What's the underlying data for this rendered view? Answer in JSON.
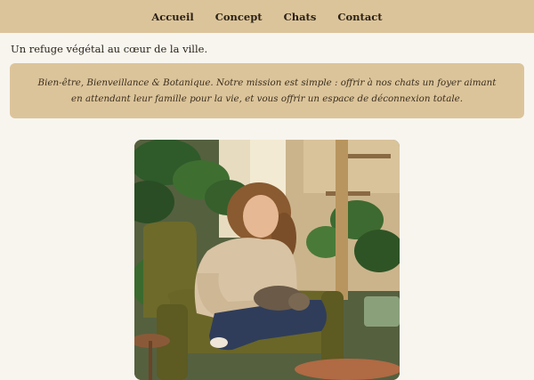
{
  "nav": {
    "items": [
      {
        "label": "Accueil"
      },
      {
        "label": "Concept"
      },
      {
        "label": "Chats"
      },
      {
        "label": "Contact"
      }
    ]
  },
  "main": {
    "tagline": "Un refuge végétal au cœur de la ville.",
    "mission": "Bien-être, Bienveillance & Botanique. Notre mission est simple : offrir à nos chats un foyer aimant en attendant leur famille pour la vie, et vous offrir un espace de déconnexion totale."
  },
  "colors": {
    "nav_bg": "#dcc49a",
    "page_bg": "#f8f5ef",
    "mission_bg": "#dcc49a"
  }
}
